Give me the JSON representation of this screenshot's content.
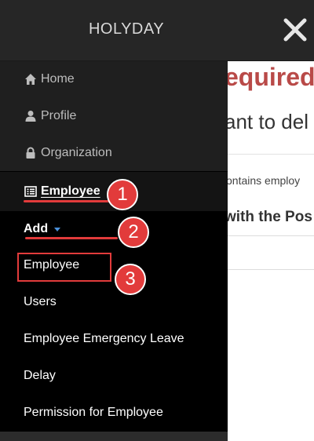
{
  "header": {
    "brand": "HOLYDAY",
    "close_icon": "close-icon"
  },
  "background": {
    "title": "equired",
    "question": "ant to del",
    "note": "ontains employ",
    "strong": "with the Pos"
  },
  "nav": {
    "items": [
      {
        "label": "Home",
        "icon": "home-icon"
      },
      {
        "label": "Profile",
        "icon": "user-icon"
      },
      {
        "label": "Organization",
        "icon": "lock-icon"
      },
      {
        "label": "Employee",
        "icon": "list-icon"
      }
    ],
    "add_label": "Add"
  },
  "submenu": {
    "items": [
      {
        "label": "Employee"
      },
      {
        "label": "Users"
      },
      {
        "label": "Employee Emergency Leave"
      },
      {
        "label": "Delay"
      },
      {
        "label": "Permission for Employee"
      }
    ]
  },
  "annotations": {
    "steps": [
      "1",
      "2",
      "3"
    ],
    "accent_color": "#e23b3b"
  }
}
